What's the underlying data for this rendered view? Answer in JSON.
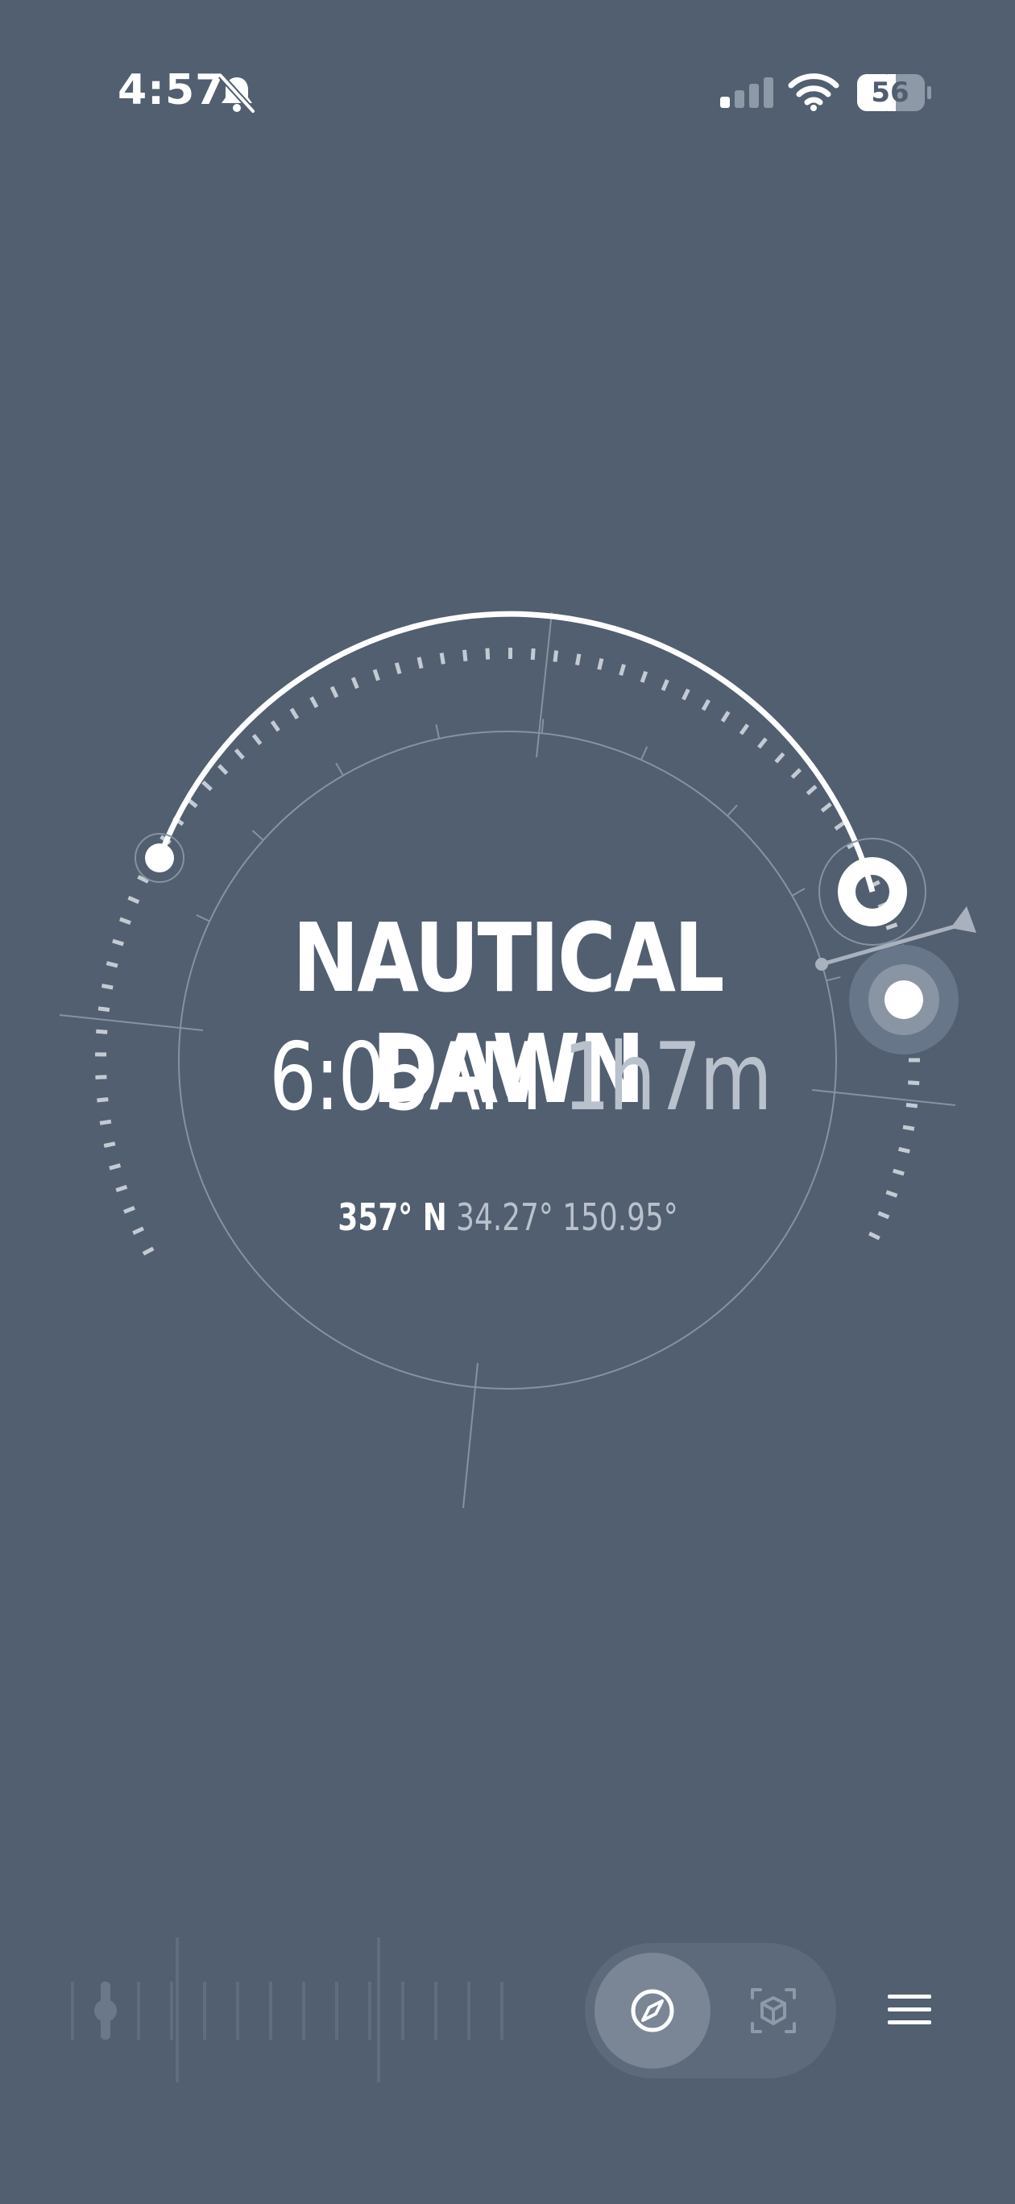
{
  "status_bar": {
    "time": "4:57",
    "battery_level": "56",
    "signal_bars_active": 1,
    "signal_bars_total": 4,
    "icons": [
      "bell-slash-icon",
      "cellular-signal-icon",
      "wifi-icon",
      "battery-icon"
    ]
  },
  "main": {
    "phase_name": "NAUTICAL DAWN",
    "phase_time": "6:05AM",
    "time_remaining": "1h7m",
    "heading": "357° N",
    "latitude": "34.27°",
    "longitude": "150.95°"
  },
  "bottom": {
    "icons": [
      "timeline-scrubber",
      "compass-icon",
      "ar-cube-icon",
      "menu-icon"
    ],
    "active_mode": "compass"
  },
  "colors": {
    "background": "#515f70",
    "primary_text": "#ffffff",
    "secondary_text": "#b9c1cc"
  }
}
